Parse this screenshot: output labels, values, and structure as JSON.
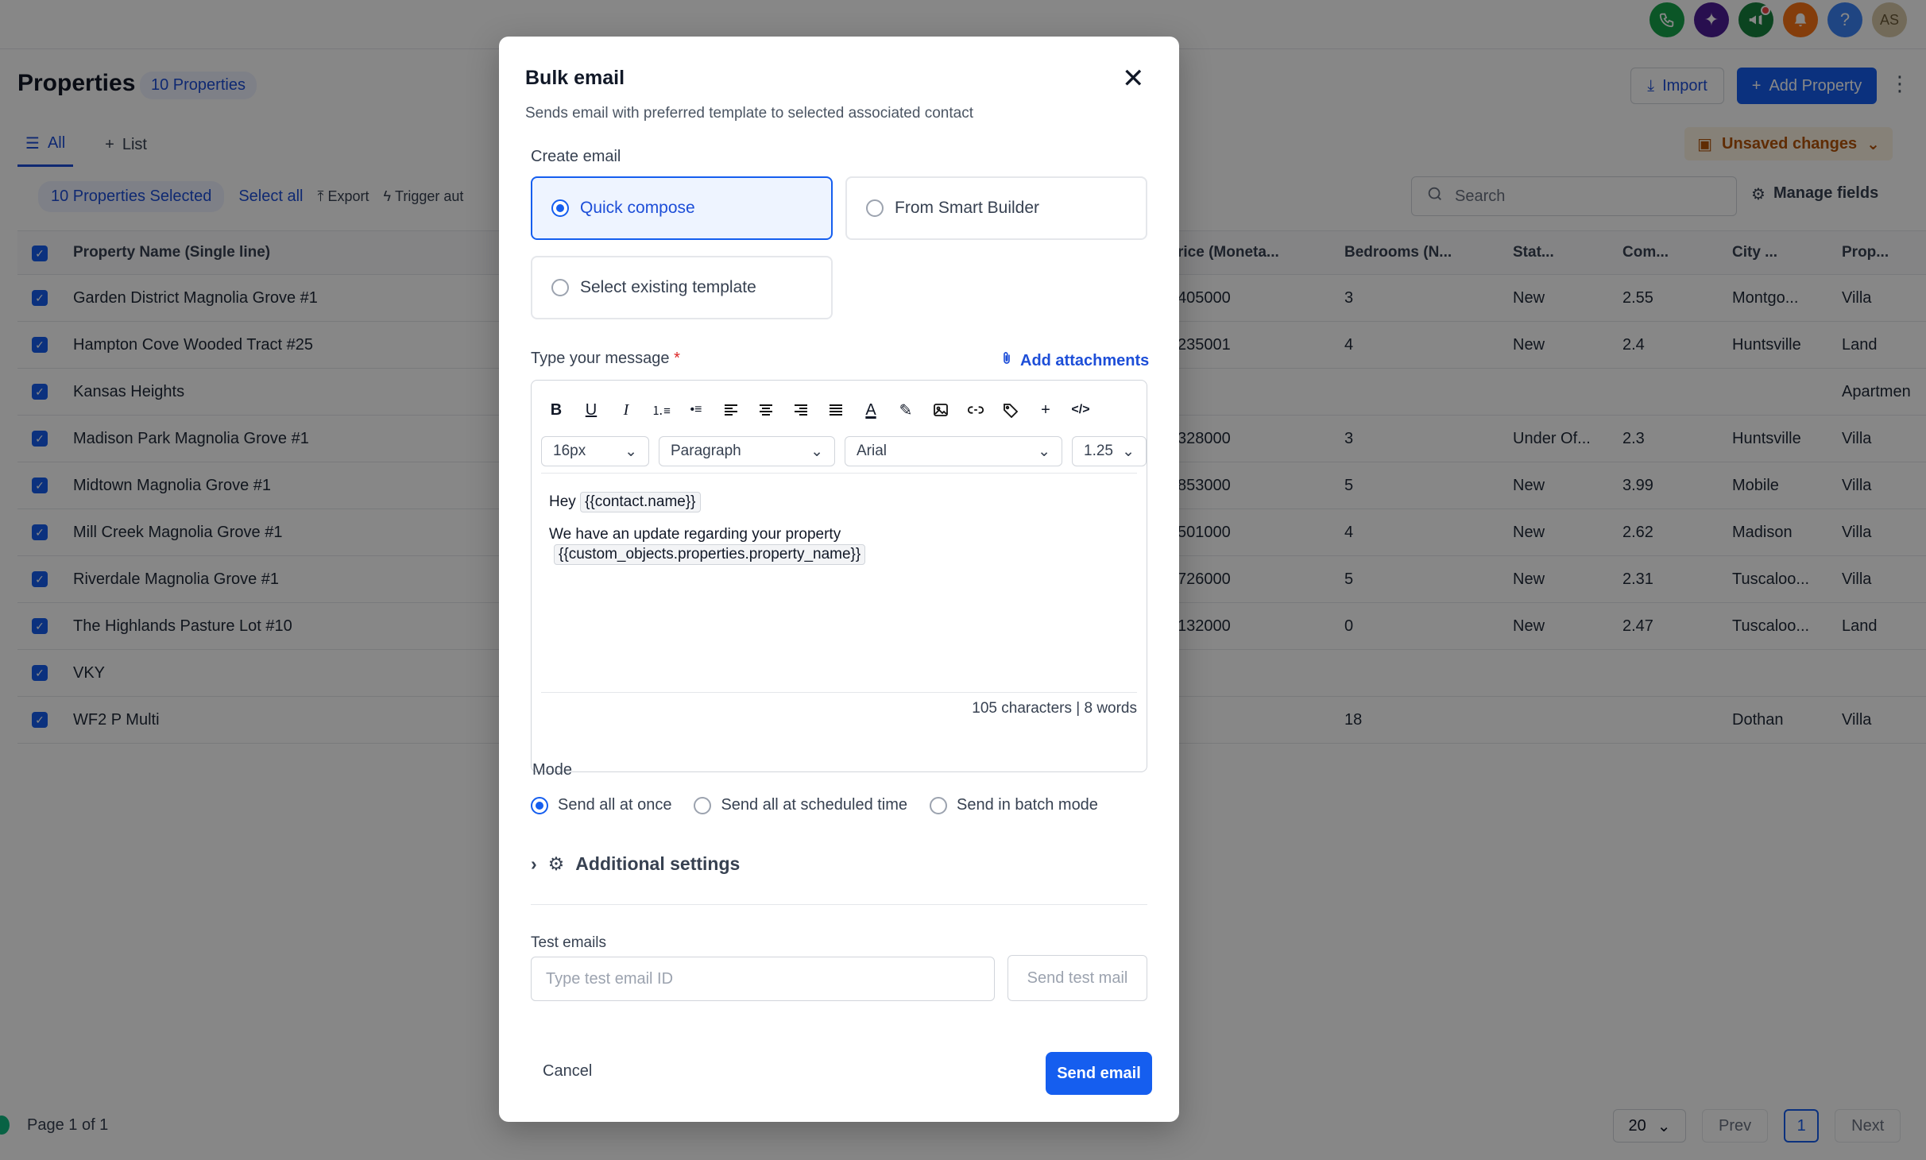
{
  "header": {
    "title": "Properties",
    "count_badge": "10 Properties",
    "import_label": "Import",
    "add_label": "Add Property",
    "avatar": "AS",
    "icons": [
      "phone-icon",
      "sparkle-icon",
      "megaphone-icon",
      "bell-icon",
      "help-icon"
    ]
  },
  "tabs": [
    {
      "label": "All",
      "active": true
    },
    {
      "label": "List",
      "active": false
    }
  ],
  "unsaved_label": "Unsaved changes",
  "selection": {
    "count_label": "10 Properties Selected",
    "select_all": "Select all",
    "export": "Export",
    "trigger": "Trigger aut"
  },
  "search_placeholder": "Search",
  "manage_fields": "Manage fields",
  "table": {
    "columns": [
      "Property Name (Single line)",
      "rice (Moneta...",
      "Bedrooms (N...",
      "Stat...",
      "Com...",
      "City ...",
      "Prop..."
    ],
    "rows": [
      [
        "Garden District Magnolia Grove #1",
        "405000",
        "3",
        "New",
        "2.55",
        "Montgo...",
        "Villa"
      ],
      [
        "Hampton Cove Wooded Tract #25",
        "235001",
        "4",
        "New",
        "2.4",
        "Huntsville",
        "Land"
      ],
      [
        "Kansas Heights",
        "",
        "",
        "",
        "",
        "",
        "Apartmen"
      ],
      [
        "Madison Park Magnolia Grove #1",
        "328000",
        "3",
        "Under Of...",
        "2.3",
        "Huntsville",
        "Villa"
      ],
      [
        "Midtown Magnolia Grove #1",
        "853000",
        "5",
        "New",
        "3.99",
        "Mobile",
        "Villa"
      ],
      [
        "Mill Creek Magnolia Grove #1",
        "501000",
        "4",
        "New",
        "2.62",
        "Madison",
        "Villa"
      ],
      [
        "Riverdale Magnolia Grove #1",
        "726000",
        "5",
        "New",
        "2.31",
        "Tuscaloo...",
        "Villa"
      ],
      [
        "The Highlands Pasture Lot #10",
        "132000",
        "0",
        "New",
        "2.47",
        "Tuscaloo...",
        "Land"
      ],
      [
        "VKY",
        "",
        "",
        "",
        "",
        "",
        ""
      ],
      [
        "WF2 P Multi",
        "",
        "18",
        "",
        "",
        "Dothan",
        "Villa"
      ]
    ]
  },
  "footer": {
    "page_info": "Page 1 of 1",
    "page_size": "20",
    "prev": "Prev",
    "current": "1",
    "next": "Next"
  },
  "modal": {
    "title": "Bulk email",
    "subtitle": "Sends email with preferred template to selected associated contact",
    "create_label": "Create email",
    "options": [
      "Quick compose",
      "From Smart Builder",
      "Select existing template"
    ],
    "selected_option": "Quick compose",
    "message_label": "Type your message",
    "required_mark": "*",
    "add_attachments": "Add attachments",
    "editor": {
      "font_size": "16px",
      "block": "Paragraph",
      "font": "Arial",
      "line_height": "1.25",
      "greeting": "Hey",
      "var_contact": "{{contact.name}}",
      "line2": "We have an update regarding your property",
      "var_property": "{{custom_objects.properties.property_name}}",
      "counter": "105 characters | 8 words"
    },
    "mode_label": "Mode",
    "modes": [
      "Send all at once",
      "Send all at scheduled time",
      "Send in batch mode"
    ],
    "selected_mode": "Send all at once",
    "additional_settings": "Additional settings",
    "test_label": "Test emails",
    "test_placeholder": "Type test email ID",
    "send_test": "Send test mail",
    "cancel": "Cancel",
    "send": "Send email"
  },
  "colors": {
    "primary": "#155eef",
    "overlay": "rgba(0,0,0,0.47)",
    "unsaved_bg": "#fef3e2",
    "unsaved_text": "#b45309"
  }
}
